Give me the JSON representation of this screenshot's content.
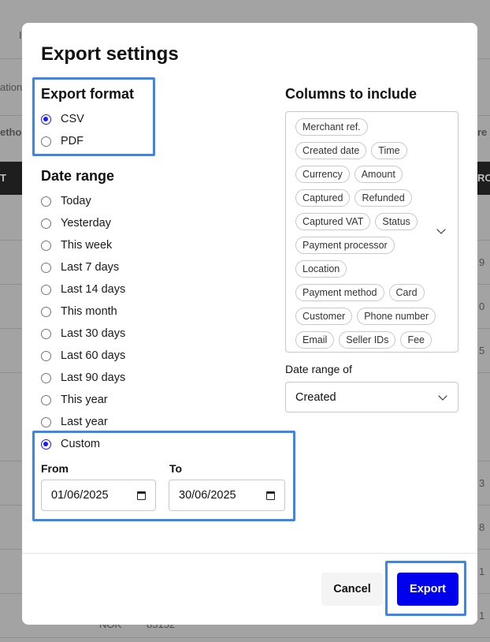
{
  "background": {
    "texts": [
      "I",
      "ation",
      "ethod",
      "T",
      "re",
      "RO",
      "9",
      "0",
      "5",
      "3",
      "8",
      "1",
      "1",
      "NOK",
      "85152"
    ]
  },
  "modal": {
    "title": "Export settings",
    "export_format": {
      "title": "Export format",
      "options": [
        {
          "label": "CSV",
          "checked": true
        },
        {
          "label": "PDF",
          "checked": false
        }
      ]
    },
    "date_range": {
      "title": "Date range",
      "options": [
        {
          "label": "Today",
          "checked": false
        },
        {
          "label": "Yesterday",
          "checked": false
        },
        {
          "label": "This week",
          "checked": false
        },
        {
          "label": "Last 7 days",
          "checked": false
        },
        {
          "label": "Last 14 days",
          "checked": false
        },
        {
          "label": "This month",
          "checked": false
        },
        {
          "label": "Last 30 days",
          "checked": false
        },
        {
          "label": "Last 60 days",
          "checked": false
        },
        {
          "label": "Last 90 days",
          "checked": false
        },
        {
          "label": "This year",
          "checked": false
        },
        {
          "label": "Last year",
          "checked": false
        },
        {
          "label": "Custom",
          "checked": true
        }
      ],
      "from_label": "From",
      "from_value": "01/06/2025",
      "to_label": "To",
      "to_value": "30/06/2025"
    },
    "columns": {
      "title": "Columns to include",
      "chips": [
        "Merchant ref.",
        "Created date",
        "Time",
        "Currency",
        "Amount",
        "Captured",
        "Refunded",
        "Captured VAT",
        "Status",
        "Payment processor",
        "Location",
        "Payment method",
        "Card",
        "Customer",
        "Phone number",
        "Email",
        "Seller IDs",
        "Fee"
      ]
    },
    "date_range_of": {
      "label": "Date range of",
      "value": "Created"
    },
    "buttons": {
      "cancel": "Cancel",
      "export": "Export"
    }
  },
  "colors": {
    "accent": "#0000ee",
    "highlight": "#3d86e8"
  }
}
